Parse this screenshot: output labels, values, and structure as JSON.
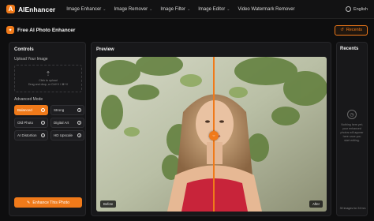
{
  "brand": {
    "name": "AIEnhancer",
    "logo_letter": "A"
  },
  "nav": {
    "items": [
      {
        "label": "Image Enhancer",
        "chevron": "⌄"
      },
      {
        "label": "Image Remover",
        "chevron": "⌄"
      },
      {
        "label": "Image Filter",
        "chevron": "⌄"
      },
      {
        "label": "Image Editor",
        "chevron": "⌄"
      },
      {
        "label": "Video Watermark Remover",
        "chevron": ""
      }
    ],
    "language": "English"
  },
  "header": {
    "title": "Free AI Photo Enhancer",
    "recents_button": "Recents"
  },
  "controls": {
    "title": "Controls",
    "upload_label": "Upload Your Image",
    "upload_hint_1": "Click to upload",
    "upload_hint_2": "Drag and drop, or Ctrl+V / ⌘+V",
    "mode_label": "Advanced Mode",
    "modes": [
      {
        "label": "Balanced",
        "active": true
      },
      {
        "label": "Strong",
        "active": false
      },
      {
        "label": "Old Photo",
        "active": false
      },
      {
        "label": "Digital Art",
        "active": false
      },
      {
        "label": "AI Distortion",
        "active": false
      },
      {
        "label": "HD Upscale",
        "active": false
      }
    ],
    "enhance_button": "Enhance This Photo"
  },
  "preview": {
    "title": "Preview",
    "before_label": "Before",
    "after_label": "After",
    "split_percent": 51
  },
  "recents": {
    "title": "Recents",
    "empty_text": "Nothing here yet; your enhanced photos will appear here once you start editing.",
    "footer": "30 images for 24 hrs"
  },
  "colors": {
    "accent": "#f07a1a",
    "background": "#0e0e0f",
    "panel": "#18181a"
  }
}
